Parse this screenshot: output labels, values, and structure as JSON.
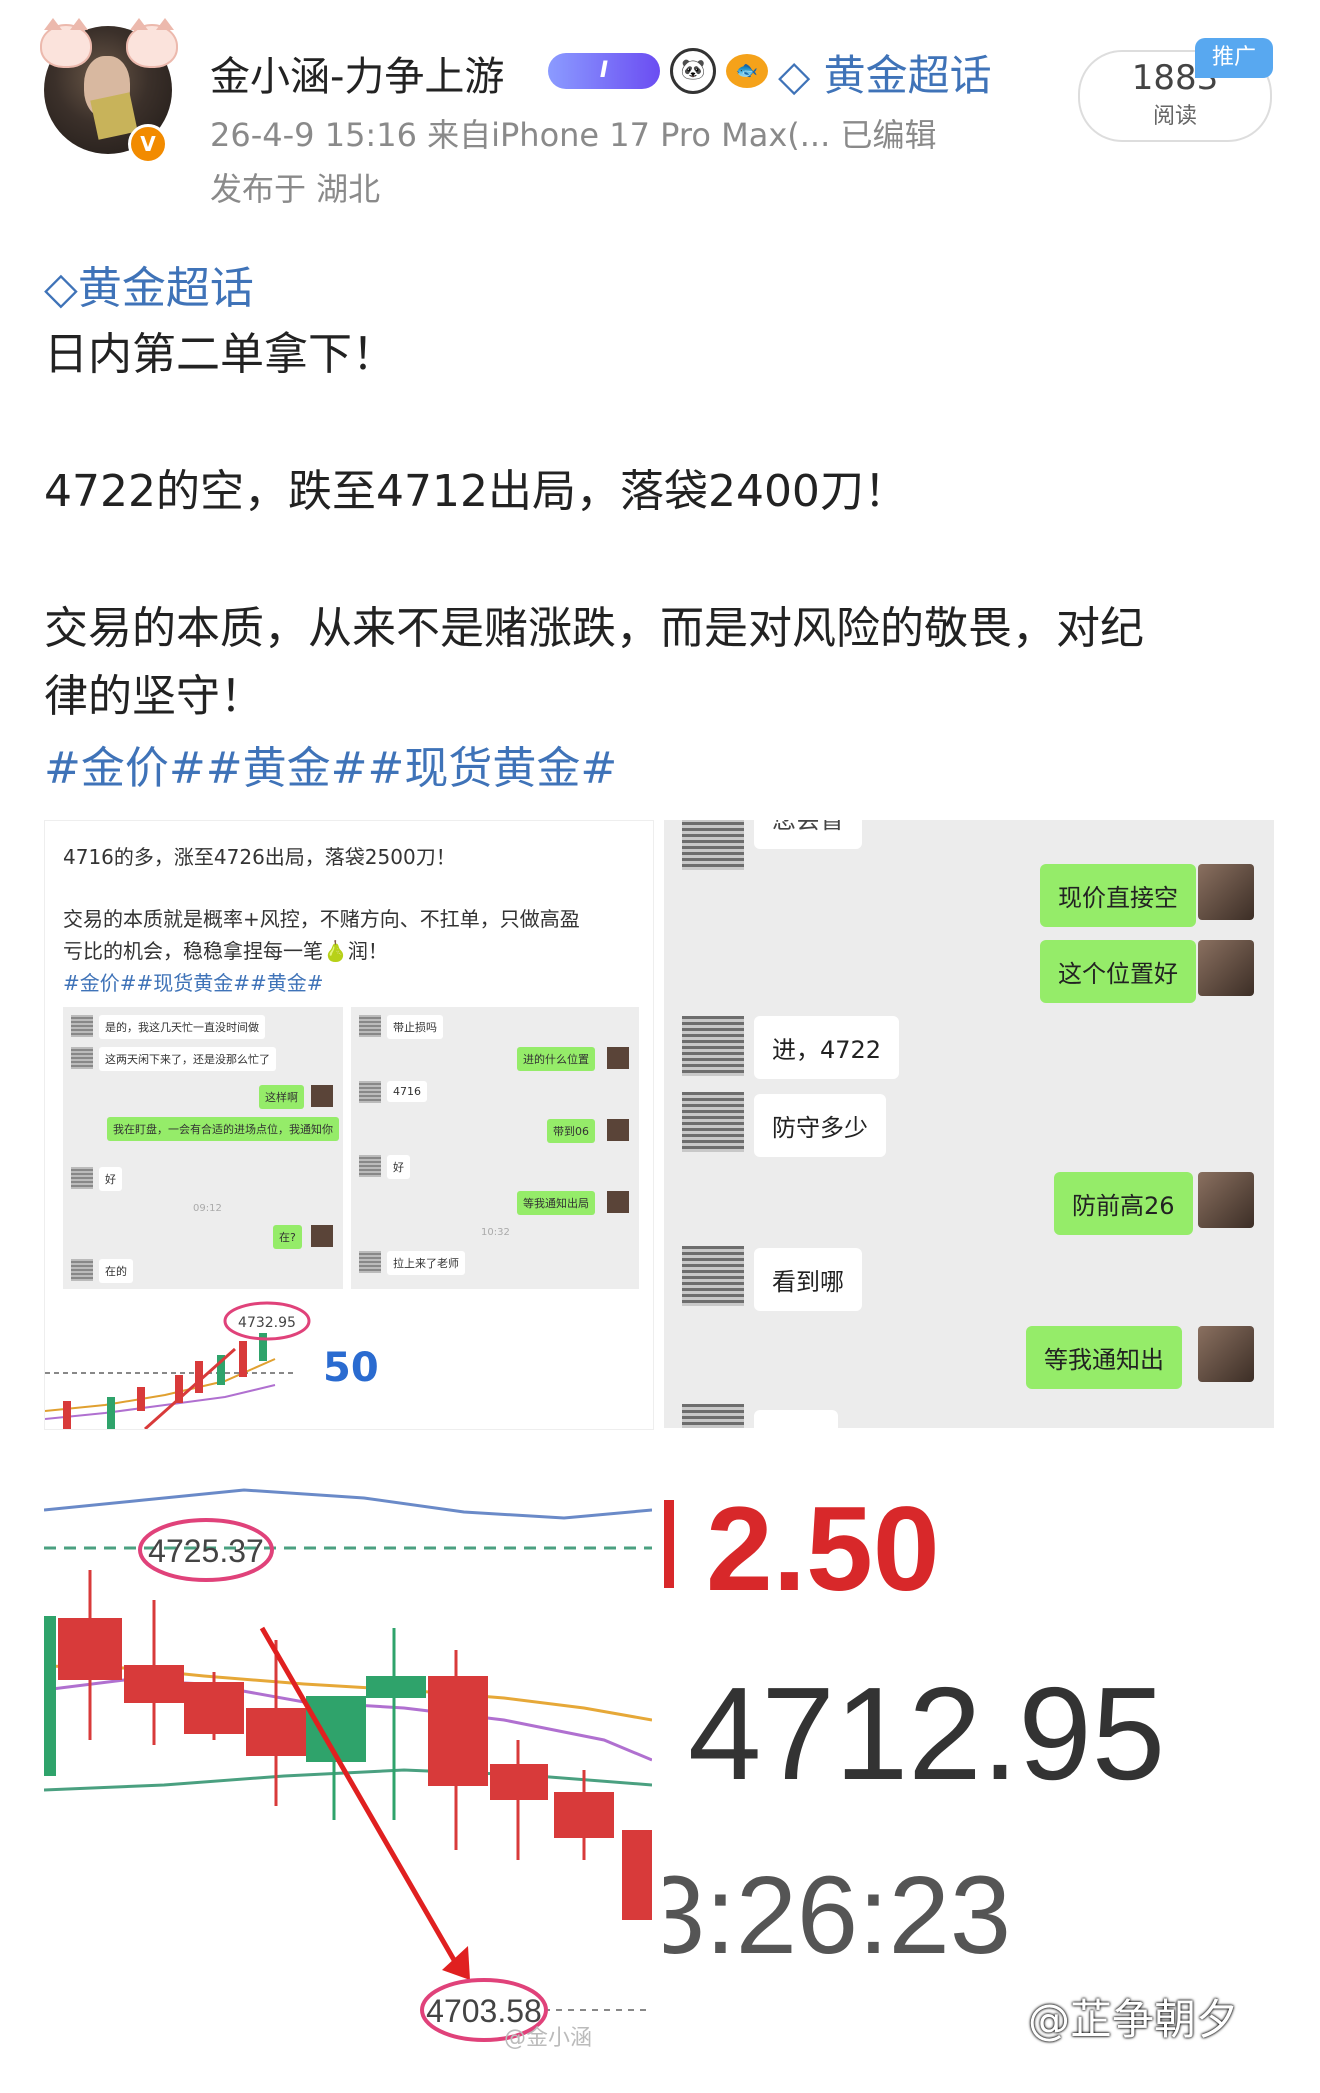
{
  "post": {
    "author": "金小涵-力争上游",
    "vip_level": "I",
    "super_topic_label": "黄金超话",
    "promo_badge": "推广",
    "read_count": "1883",
    "read_label": "阅读",
    "meta": "26-4-9 15:16  来自iPhone 17 Pro Max(...  已编辑",
    "location": "发布于 湖北",
    "topic_link": "黄金超话",
    "lines": [
      "日内第二单拿下！",
      "4722的空，跌至4712出局，落袋2400刀！",
      "交易的本质，从来不是赌涨跌，而是对风险的敬畏，对纪",
      "律的坚守！"
    ],
    "hashtags": "#金价##黄金##现货黄金#"
  },
  "image1": {
    "line1": "4716的多，涨至4726出局，落袋2500刀！",
    "line2": "交易的本质就是概率+风控，不赌方向、不扛单，只做高盈",
    "line3": "亏比的机会，稳稳拿捏每一笔🍐润！",
    "tags": "#金价##现货黄金##黄金#",
    "chatA": {
      "in1": "是的，我这几天忙一直没时间做",
      "in2": "这两天闲下来了，还是没那么忙了",
      "out1": "这样啊",
      "out2": "我在盯盘，一会有合适的进场点位，我通知你",
      "in3": "好",
      "time": "09:12",
      "out3": "在?",
      "in4": "在的"
    },
    "chatB": {
      "in1": "带止损吗",
      "out1": "进的什么位置",
      "in2": "4716",
      "out2": "带到06",
      "in3": "好",
      "out3": "等我通知出局",
      "time": "10:32",
      "in4": "拉上来了老师"
    },
    "chart_price_label": "4732.95",
    "chart_big_number": "50"
  },
  "image2": {
    "top_cut": "您会盲",
    "msgs": {
      "out1": "现价直接空",
      "out2": "这个位置好",
      "in1": "进，4722",
      "in2": "防守多少",
      "out3": "防前高26",
      "in3": "看到哪",
      "out4": "等我通知出",
      "bottom_cut": "收到"
    }
  },
  "image3": {
    "high_label": "4725.37",
    "low_label": "4703.58",
    "watermark_small": "@金小涵"
  },
  "image4": {
    "change": "2.50",
    "price": "4712.95",
    "time": "3:26:23"
  },
  "watermark": "@芷争朝夕",
  "colors": {
    "link": "#3f73b8",
    "wechat_green": "#95ec69",
    "price_red": "#d8282a",
    "candle_green": "#2fa36b"
  }
}
